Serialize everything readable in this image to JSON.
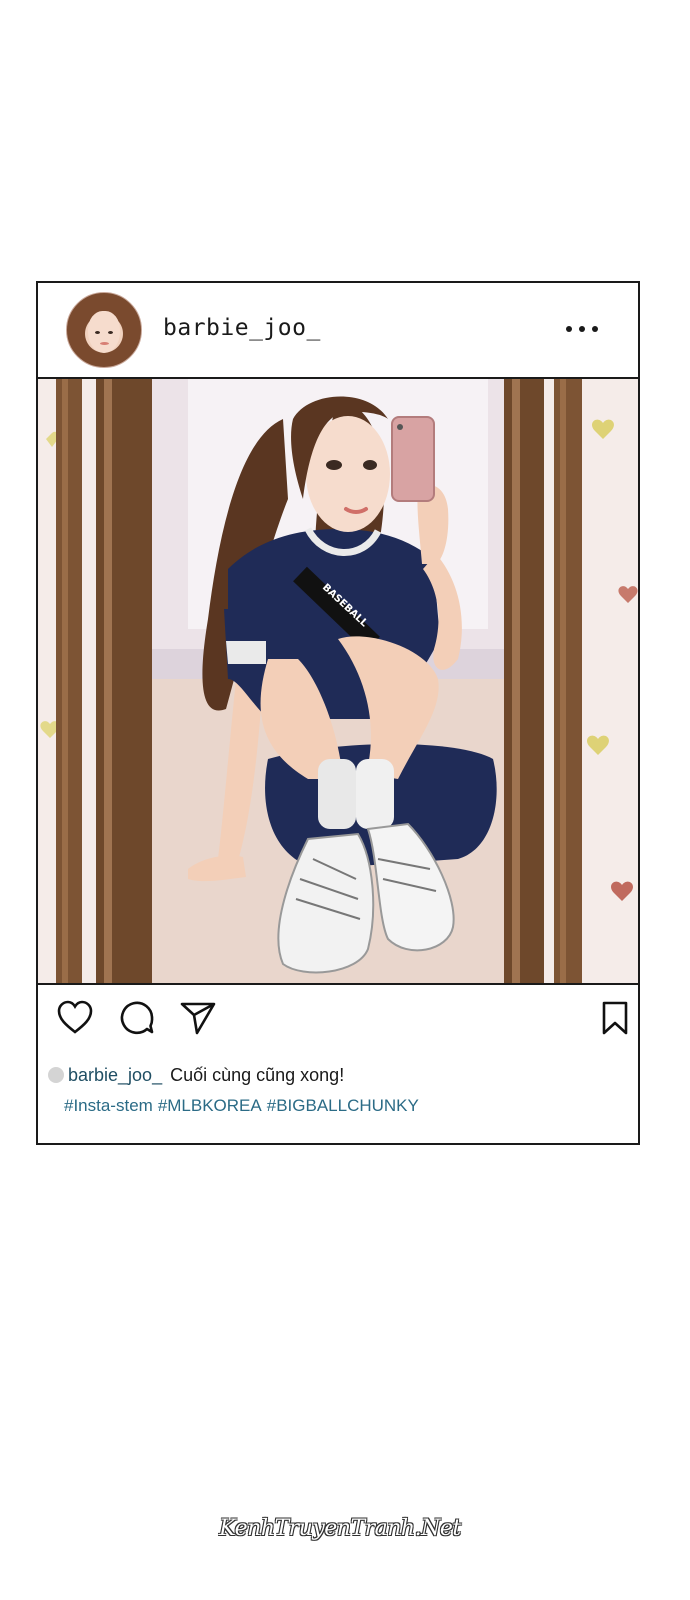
{
  "post": {
    "username": "barbie_joo_",
    "caption": {
      "username": "barbie_joo_",
      "text": "Cuối cùng cũng xong!"
    },
    "hashtags": [
      "#Insta-stem",
      "#MLBKOREA",
      "#BIGBALLCHUNKY"
    ],
    "photo": {
      "shirt_text": "BASEBALL"
    },
    "icons": {
      "menu": "more-dots-icon",
      "like": "heart-icon",
      "comment": "comment-bubble-icon",
      "share": "paper-plane-icon",
      "save": "bookmark-icon"
    }
  },
  "watermark": "KenhTruyenTranh.Net",
  "colors": {
    "border": "#1a1a1a",
    "hashtag": "#2b6b86",
    "caption_user": "#1f4e63"
  }
}
